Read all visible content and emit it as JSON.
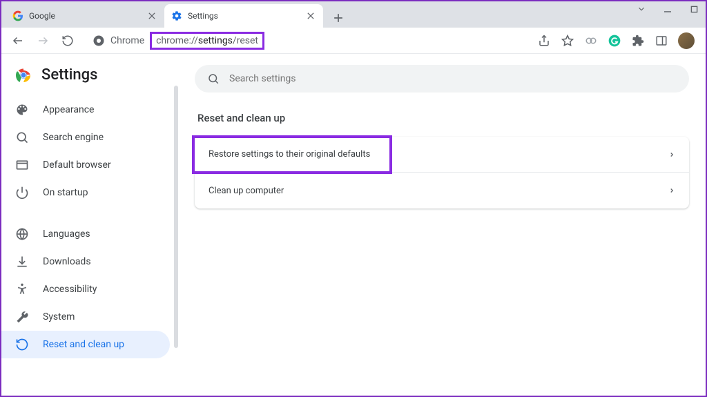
{
  "window": {
    "tabs": [
      {
        "title": "Google",
        "active": false
      },
      {
        "title": "Settings",
        "active": true
      }
    ]
  },
  "toolbar": {
    "url_prefix": "Chrome",
    "url_proto": "chrome://",
    "url_path1": "settings",
    "url_path2": "/reset"
  },
  "settings": {
    "title": "Settings",
    "search_placeholder": "Search settings"
  },
  "sidebar": {
    "items": [
      {
        "label": "Appearance"
      },
      {
        "label": "Search engine"
      },
      {
        "label": "Default browser"
      },
      {
        "label": "On startup"
      },
      {
        "label": "Languages"
      },
      {
        "label": "Downloads"
      },
      {
        "label": "Accessibility"
      },
      {
        "label": "System"
      },
      {
        "label": "Reset and clean up"
      }
    ]
  },
  "main": {
    "section_title": "Reset and clean up",
    "rows": [
      {
        "label": "Restore settings to their original defaults"
      },
      {
        "label": "Clean up computer"
      }
    ]
  }
}
